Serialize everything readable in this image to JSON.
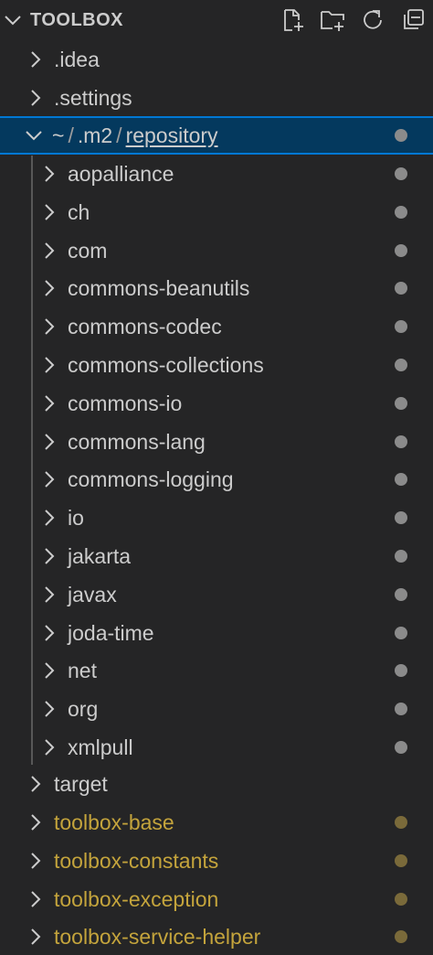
{
  "panel": {
    "title": "TOOLBOX",
    "actions": [
      {
        "name": "new-file-icon"
      },
      {
        "name": "new-folder-icon"
      },
      {
        "name": "refresh-icon"
      },
      {
        "name": "collapse-all-icon"
      }
    ]
  },
  "tree": {
    "idea": ".idea",
    "settings": ".settings",
    "repository": {
      "seg1": "~",
      "sep1": "/",
      "seg2": ".m2",
      "sep2": "/",
      "seg3": "repository"
    },
    "children": [
      "aopalliance",
      "ch",
      "com",
      "commons-beanutils",
      "commons-codec",
      "commons-collections",
      "commons-io",
      "commons-lang",
      "commons-logging",
      "io",
      "jakarta",
      "javax",
      "joda-time",
      "net",
      "org",
      "xmlpull"
    ],
    "target": "target",
    "ignored": [
      "toolbox-base",
      "toolbox-constants",
      "toolbox-exception",
      "toolbox-service-helper"
    ]
  },
  "colors": {
    "background": "#252526",
    "selection": "#04395e",
    "focus_border": "#0078d4",
    "ignored_text": "#c4a43c",
    "decoration_dot": "#8b8b8b",
    "ignored_dot": "#7a6a3a"
  }
}
